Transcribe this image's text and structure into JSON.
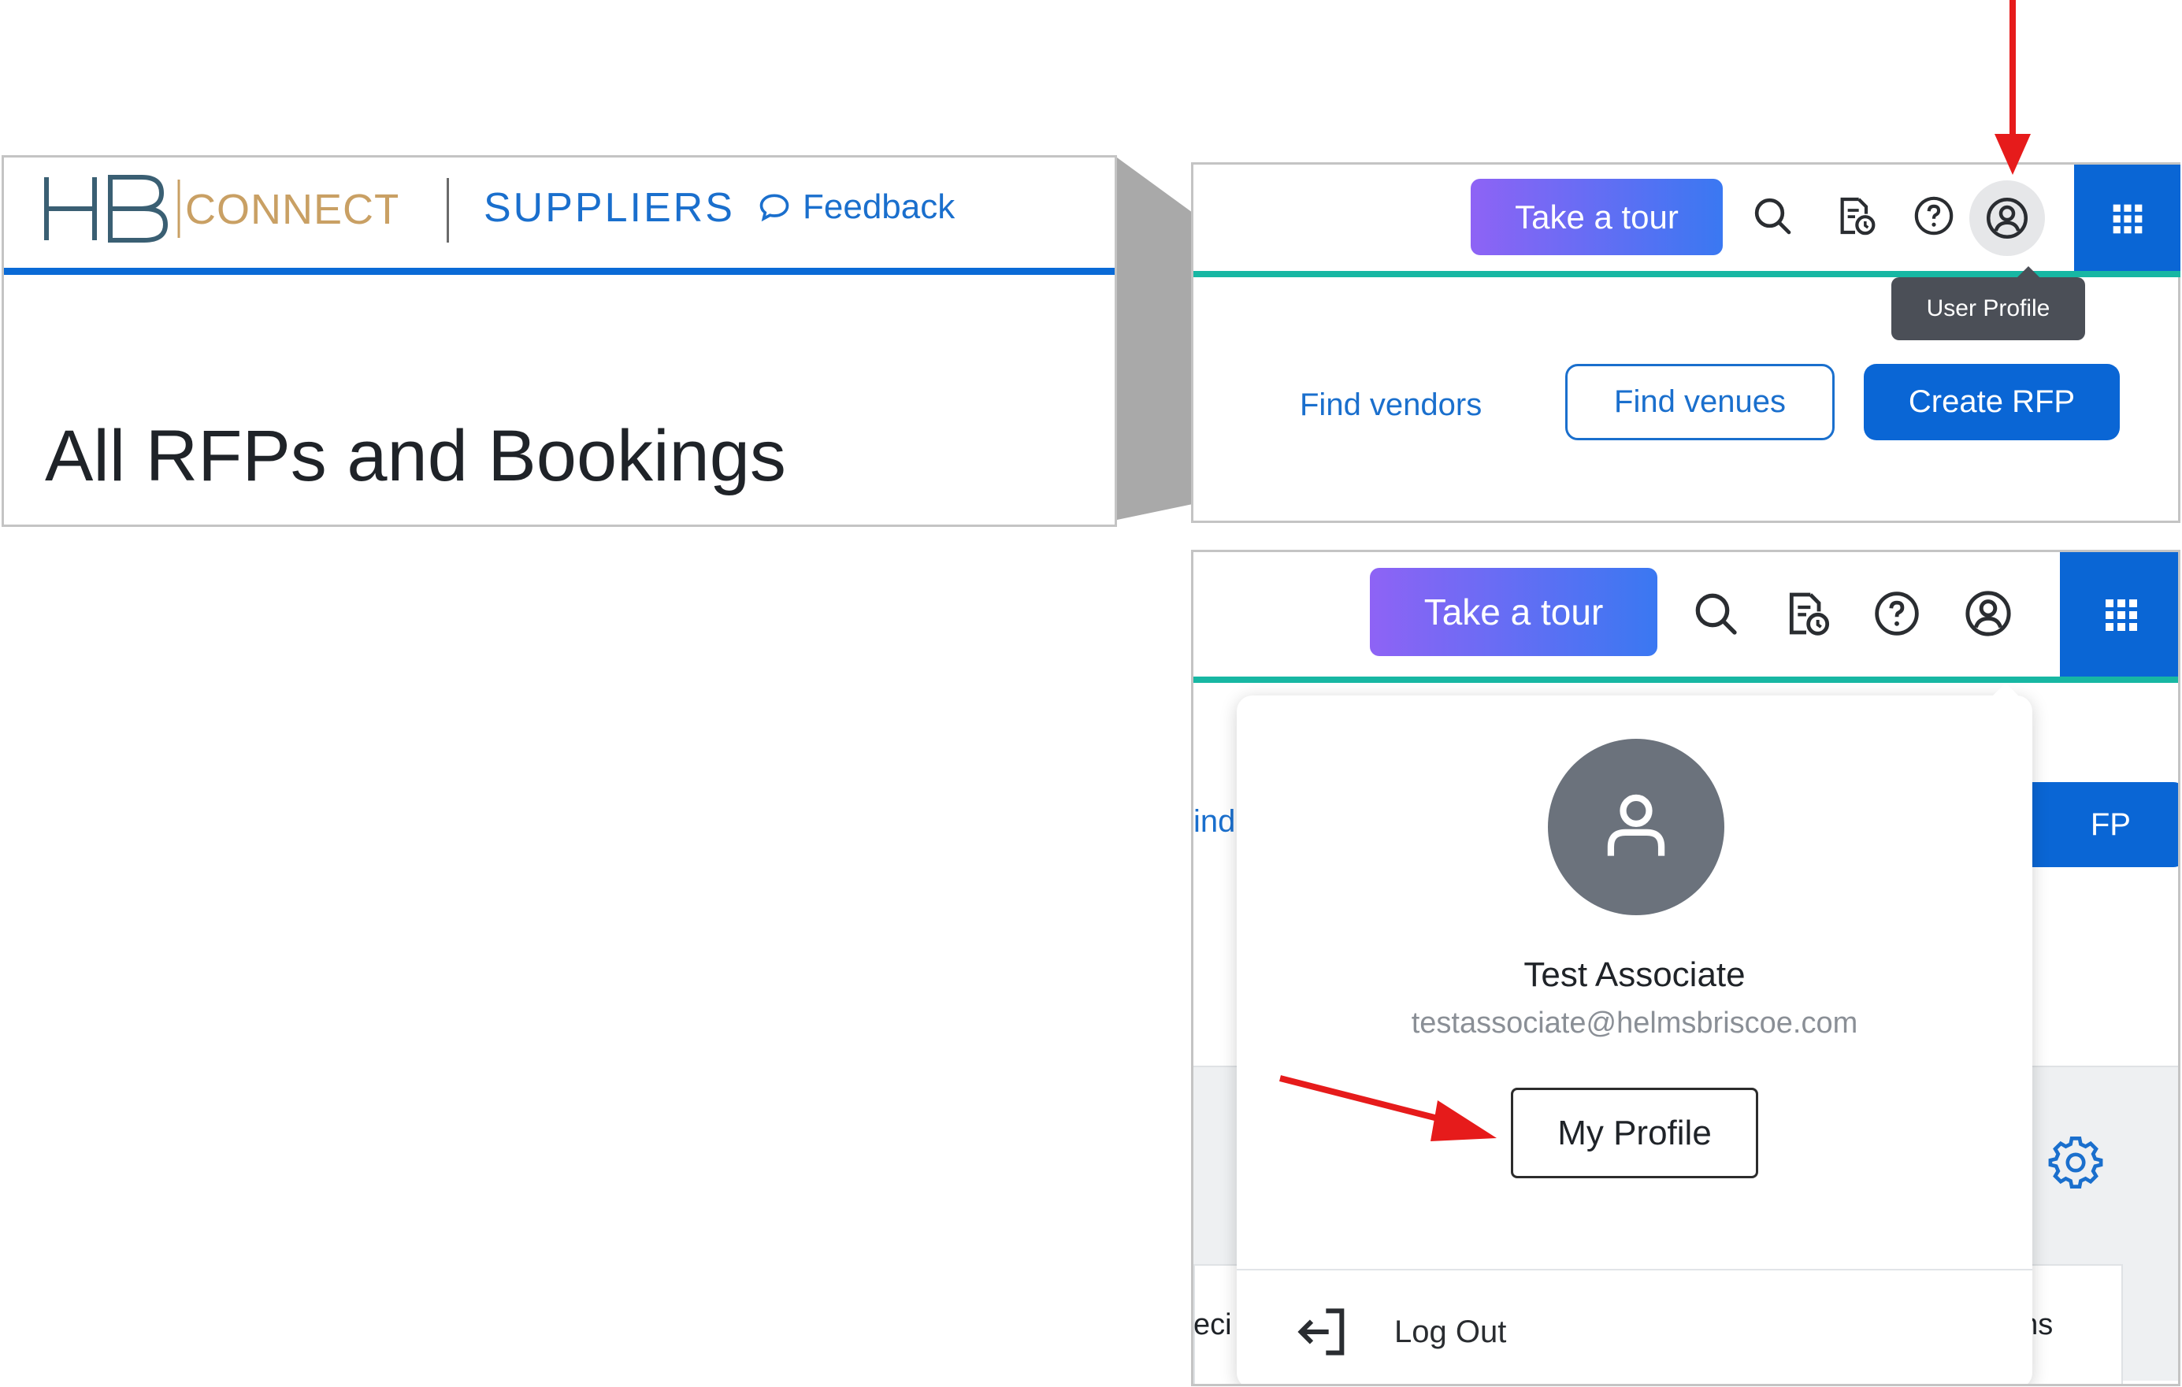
{
  "brand": {
    "logo_letters": "HB",
    "logo_word": "CONNECT"
  },
  "header": {
    "suppliers_label": "SUPPLIERS",
    "feedback_label": "Feedback",
    "page_title": "All RFPs and Bookings"
  },
  "toolbar": {
    "tour_label": "Take a tour",
    "user_profile_tooltip": "User Profile",
    "icons": [
      "search-icon",
      "report-clock-icon",
      "help-icon",
      "user-circle-icon",
      "apps-grid-icon"
    ]
  },
  "actions": {
    "find_vendors": "Find vendors",
    "find_venues": "Find venues",
    "create_rfp": "Create RFP"
  },
  "profile_menu": {
    "name": "Test Associate",
    "email": "testassociate@helmsbriscoe.com",
    "my_profile_label": "My Profile",
    "logout_label": "Log Out"
  },
  "background_fragments": {
    "left_link": "ind",
    "right_button": "FP",
    "row_left": "eci",
    "row_right": "ons"
  },
  "colors": {
    "primary_blue": "#0a66d5",
    "link_blue": "#1a6fcd",
    "teal_line": "#17b7a3",
    "tour_gradient_start": "#8e63f5",
    "tour_gradient_end": "#3a78f2",
    "annotation_red": "#e61b1b"
  }
}
